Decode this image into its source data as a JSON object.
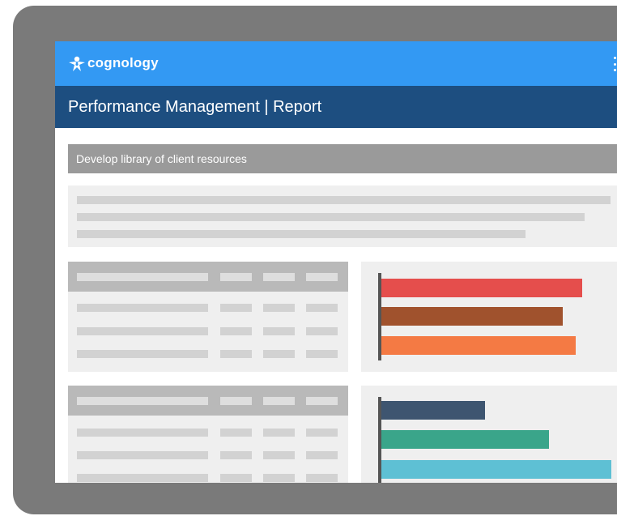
{
  "app": {
    "logo_text": "cognology",
    "title": "Performance Management | Report"
  },
  "report": {
    "task_title": "Develop library of client resources"
  },
  "charts": [
    {
      "name": "chart-1",
      "bars": [
        {
          "value": 0.92,
          "color": "#e54e4c"
        },
        {
          "value": 0.83,
          "color": "#a0522d"
        },
        {
          "value": 0.89,
          "color": "#f47a44"
        }
      ]
    },
    {
      "name": "chart-2",
      "bars": [
        {
          "value": 0.45,
          "color": "#3e5570"
        },
        {
          "value": 0.73,
          "color": "#3aa58a"
        },
        {
          "value": 1.0,
          "color": "#5ec0d4"
        }
      ]
    }
  ]
}
